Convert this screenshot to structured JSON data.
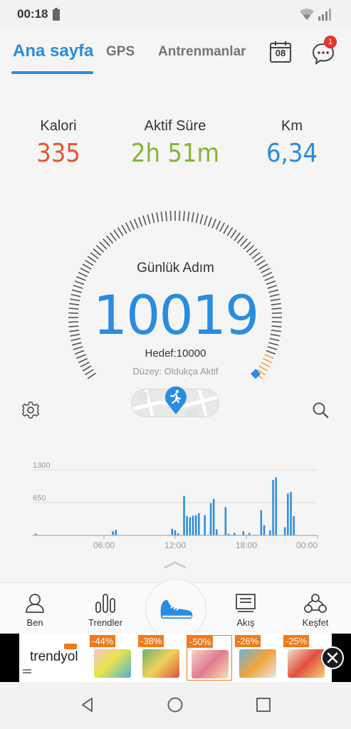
{
  "status_bar": {
    "time": "00:18"
  },
  "tabs": {
    "home": "Ana sayfa",
    "gps": "GPS",
    "training": "Antrenmanlar"
  },
  "header": {
    "calendar_day": "08",
    "notification_count": "1"
  },
  "stats": {
    "calories": {
      "label": "Kalori",
      "value": "335",
      "color": "#e8552d"
    },
    "active_time": {
      "label": "Aktif Süre",
      "value": "2h 51m",
      "color": "#84b533"
    },
    "km": {
      "label": "Km",
      "value": "6,34",
      "color": "#2a8ce0"
    }
  },
  "gauge": {
    "title": "Günlük Adım",
    "steps": "10019",
    "goal": "Hedef:10000",
    "level": "Düzey: Oldukça Aktif",
    "progress_fraction": 1.0
  },
  "chart_data": {
    "type": "bar",
    "ylim": [
      0,
      1300
    ],
    "y_ticks": [
      "1300",
      "650"
    ],
    "x_ticks": [
      "06:00",
      "12:00",
      "18:00",
      "00:00"
    ],
    "x_tick_positions": [
      6,
      12,
      18,
      24
    ],
    "bar_width_hours": 0.25,
    "color": "#2a8ce0",
    "x": [
      0.25,
      6.75,
      7.0,
      11.75,
      12.0,
      12.25,
      12.75,
      13.0,
      13.25,
      13.5,
      13.75,
      14.0,
      14.5,
      15.0,
      15.25,
      15.5,
      16.25,
      16.5,
      17.0,
      17.75,
      18.25,
      19.25,
      19.5,
      20.0,
      20.25,
      20.5,
      21.25,
      21.5,
      21.75,
      22.0,
      22.25
    ],
    "values": [
      35,
      80,
      110,
      130,
      100,
      40,
      780,
      380,
      360,
      390,
      400,
      440,
      400,
      640,
      720,
      120,
      560,
      30,
      50,
      80,
      50,
      500,
      200,
      100,
      1100,
      1150,
      160,
      830,
      860,
      380,
      0
    ]
  },
  "bottom_nav": {
    "me": "Ben",
    "trends": "Trendler",
    "flow": "Akış",
    "discover": "Keşfet"
  },
  "ad": {
    "brand": "trendyol",
    "discounts": [
      "-44%",
      "-38%",
      "-50%",
      "-26%",
      "-25%"
    ]
  }
}
